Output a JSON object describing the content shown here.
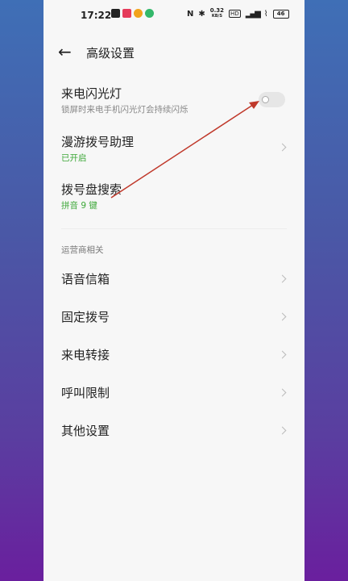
{
  "status_bar": {
    "time": "17:22",
    "speed_value": "0.32",
    "speed_unit": "KB/S",
    "battery": "46"
  },
  "header": {
    "title": "高级设置"
  },
  "settings": [
    {
      "title": "来电闪光灯",
      "subtitle": "锁屏时来电手机闪光灯会持续闪烁"
    },
    {
      "title": "漫游拨号助理",
      "subtitle": "已开启"
    },
    {
      "title": "拨号盘搜索",
      "subtitle": "拼音 9 键"
    }
  ],
  "section": {
    "label": "运营商相关",
    "items": [
      {
        "title": "语音信箱"
      },
      {
        "title": "固定拨号"
      },
      {
        "title": "来电转接"
      },
      {
        "title": "呼叫限制"
      },
      {
        "title": "其他设置"
      }
    ]
  },
  "colors": {
    "green_status": "#3ea83a",
    "arrow": "#c0392b"
  }
}
